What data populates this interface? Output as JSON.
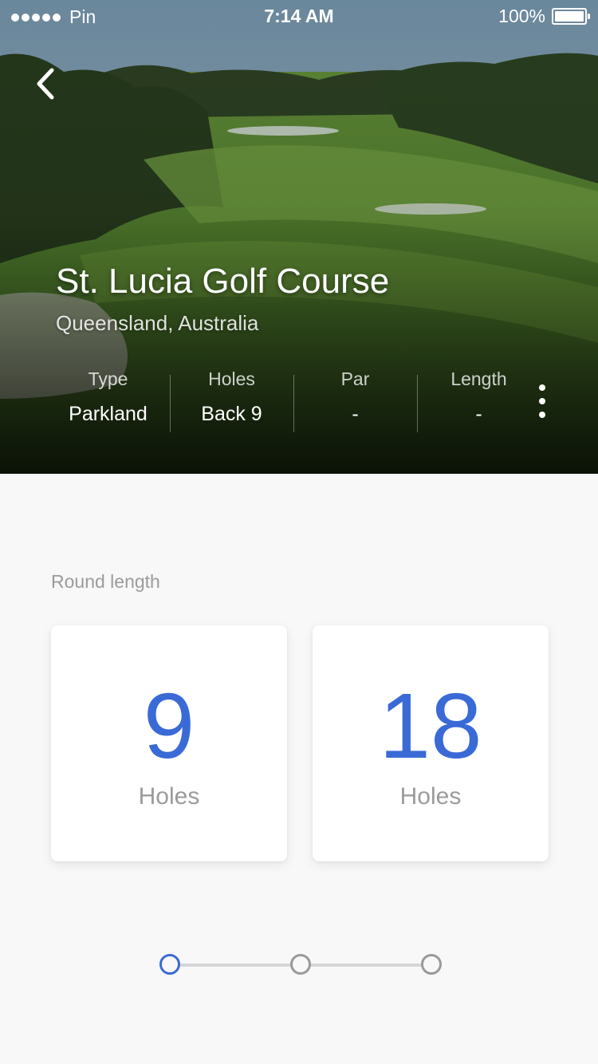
{
  "status_bar": {
    "carrier": "Pin",
    "time": "7:14 AM",
    "battery": "100%"
  },
  "course": {
    "name": "St. Lucia Golf Course",
    "location": "Queensland, Australia",
    "stats": [
      {
        "label": "Type",
        "value": "Parkland"
      },
      {
        "label": "Holes",
        "value": "Back 9"
      },
      {
        "label": "Par",
        "value": "-"
      },
      {
        "label": "Length",
        "value": "-"
      }
    ]
  },
  "round": {
    "label": "Round length",
    "options": [
      {
        "number": "9",
        "unit": "Holes"
      },
      {
        "number": "18",
        "unit": "Holes"
      }
    ]
  },
  "stepper": {
    "total_steps": 3,
    "current_step": 1
  },
  "colors": {
    "accent": "#3a6ad6",
    "muted_text": "#9b9b9b",
    "background": "#f8f8f8"
  }
}
